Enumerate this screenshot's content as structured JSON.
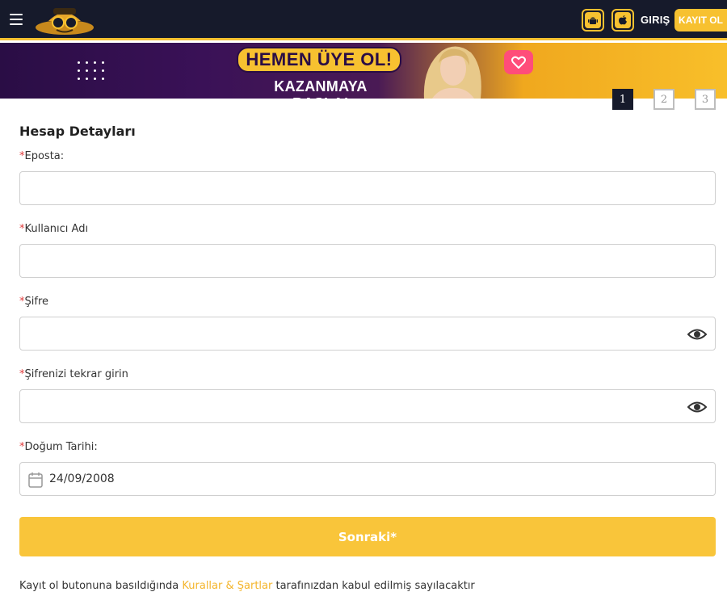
{
  "header": {
    "login_label": "GIRIŞ",
    "register_label": "KAYIT OL",
    "icons": {
      "menu": "hamburger-icon",
      "android": "android-icon",
      "apple": "apple-icon"
    }
  },
  "banner": {
    "headline": "HEMEN ÜYE OL!",
    "subline": "KAZANMAYA BAŞLA!"
  },
  "steps": [
    "1",
    "2",
    "3"
  ],
  "form": {
    "title": "Hesap Detayları",
    "required_mark": "*",
    "email_label": "Eposta:",
    "username_label": "Kullanıcı Adı",
    "password_label": "Şifre",
    "password_repeat_label": "Şifrenizi tekrar girin",
    "birthdate_label": "Doğum Tarihi:",
    "birthdate_value": "24/09/2008",
    "next_label": "Sonraki*"
  },
  "terms": {
    "prefix": "Kayıt ol butonuna basıldığında ",
    "link": "Kurallar & Şartlar",
    "suffix": " tarafınızdan kabul edilmiş sayılacaktır"
  },
  "colors": {
    "accent": "#f7c130",
    "header_bg": "#161a2b",
    "required": "#e03a3a"
  }
}
